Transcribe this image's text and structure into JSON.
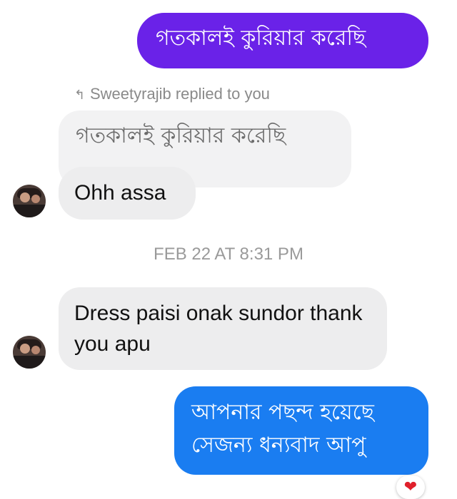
{
  "messages": {
    "sent_1": {
      "text": "গতকালই কুরিয়ার করেছি",
      "color": "#6a22e8"
    },
    "reply_label": "Sweetyrajib replied to you",
    "quoted_text": "গতকালই কুরিয়ার করেছি",
    "received_1": "Ohh assa",
    "timestamp": "FEB 22 AT 8:31 PM",
    "received_2": "Dress paisi onak sundor thank you apu",
    "sent_2": {
      "text": "আপনার পছন্দ হয়েছে সেজন্য ধন্যবাদ আপু",
      "color": "#1a7df1"
    },
    "reaction": "❤"
  },
  "icons": {
    "reply_arrow": "reply-arrow-icon",
    "reaction": "heart-icon"
  }
}
